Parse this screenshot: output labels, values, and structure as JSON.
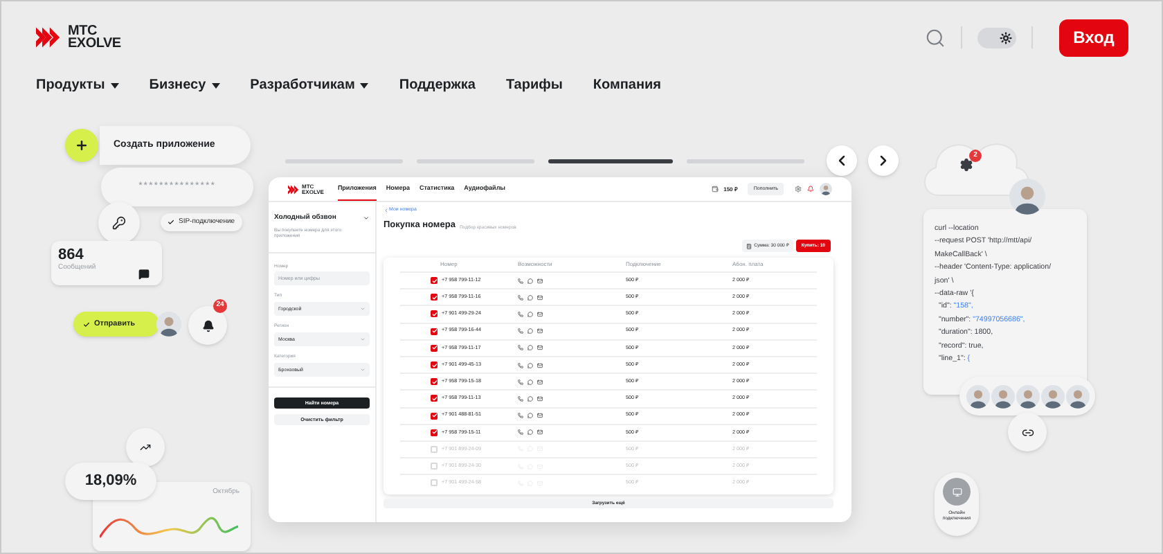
{
  "header": {
    "logo": [
      "МТС",
      "EXOLVE"
    ],
    "theme_toggle": {
      "on": true
    },
    "login_button": "Вход"
  },
  "nav": [
    {
      "label": "Продукты",
      "dropdown": true
    },
    {
      "label": "Бизнесу",
      "dropdown": true
    },
    {
      "label": "Разработчикам",
      "dropdown": true
    },
    {
      "label": "Поддержка",
      "dropdown": false
    },
    {
      "label": "Тарифы",
      "dropdown": false
    },
    {
      "label": "Компания",
      "dropdown": false
    }
  ],
  "carousel": [
    {
      "selected": false
    },
    {
      "selected": false
    },
    {
      "selected": true
    },
    {
      "selected": false
    }
  ],
  "app": {
    "logo": [
      "МТС",
      "EXOLVE"
    ],
    "tabs": [
      {
        "label": "Приложения",
        "selected": true
      },
      {
        "label": "Номера",
        "selected": false
      },
      {
        "label": "Статистика",
        "selected": false
      },
      {
        "label": "Аудиофайлы",
        "selected": false
      }
    ],
    "balance": "150 ₽",
    "topup_button": "Пополнить",
    "sidebar": {
      "title": "Холодный обзвон",
      "description": "Вы покупаете номера для этого приложения",
      "fields": [
        {
          "kind": "text",
          "label": "Номер",
          "placeholder": "Номер или цифры"
        },
        {
          "kind": "select",
          "label": "Тип",
          "value": "Городской"
        },
        {
          "kind": "select",
          "label": "Регион",
          "value": "Москва"
        },
        {
          "kind": "select",
          "label": "Категория",
          "value": "Бронзовый"
        }
      ],
      "find_button": "Найти номера",
      "clear_button": "Очистить фильтр"
    },
    "back_link": "Мои номера",
    "title": "Покупка номера",
    "subtitle": "Подбор красивых номеров",
    "sum": "Сумма: 30 000 ₽",
    "buy_button": "Купить: 10",
    "columns": [
      "Номер",
      "Возможности",
      "Подключение",
      "Абон. плата"
    ],
    "rows": [
      {
        "number": "+7 958 799-11-12",
        "connection": "500 ₽",
        "fee": "2 000 ₽",
        "checked": true
      },
      {
        "number": "+7 958 799-11-16",
        "connection": "500 ₽",
        "fee": "2 000 ₽",
        "checked": true
      },
      {
        "number": "+7 901 499-29-24",
        "connection": "500 ₽",
        "fee": "2 000 ₽",
        "checked": true
      },
      {
        "number": "+7 958 799-16-44",
        "connection": "500 ₽",
        "fee": "2 000 ₽",
        "checked": true
      },
      {
        "number": "+7 958 799-11-17",
        "connection": "500 ₽",
        "fee": "2 000 ₽",
        "checked": true
      },
      {
        "number": "+7 901 499-45-13",
        "connection": "500 ₽",
        "fee": "2 000 ₽",
        "checked": true
      },
      {
        "number": "+7 958 799-15-18",
        "connection": "500 ₽",
        "fee": "2 000 ₽",
        "checked": true
      },
      {
        "number": "+7 958 799-11-13",
        "connection": "500 ₽",
        "fee": "2 000 ₽",
        "checked": true
      },
      {
        "number": "+7 901 488-81-51",
        "connection": "500 ₽",
        "fee": "2 000 ₽",
        "checked": true
      },
      {
        "number": "+7 958 799-15-11",
        "connection": "500 ₽",
        "fee": "2 000 ₽",
        "checked": true
      },
      {
        "number": "+7 901 899-24-09",
        "connection": "500 ₽",
        "fee": "2 000 ₽",
        "checked": false
      },
      {
        "number": "+7 901 899-24-30",
        "connection": "500 ₽",
        "fee": "2 000 ₽",
        "checked": false
      },
      {
        "number": "+7 901 499-24-58",
        "connection": "500 ₽",
        "fee": "2 000 ₽",
        "checked": false
      }
    ],
    "load_more": "Загрузить ещё"
  },
  "left": {
    "create_app": "Создать приложение",
    "password": "***************",
    "sip": "SIP-подключение",
    "messages_count": "864",
    "messages_label": "Сообщений",
    "send_button": "Отправить",
    "bell_badge": "24",
    "percent": "18,09%",
    "month": "Октябрь"
  },
  "right": {
    "cloud_badge": "2",
    "code": [
      {
        "text": "curl --location"
      },
      {
        "text": "--request POST 'http://mtt/api/"
      },
      {
        "text": "MakeCallBack' \\"
      },
      {
        "text": "--header 'Content-Type: application/"
      },
      {
        "text": "json' \\"
      },
      {
        "text": "--data-raw '{"
      },
      {
        "text": "  \"id\": ",
        "value": "\"158\","
      },
      {
        "text": "  \"number\": ",
        "value": "\"74997056686\","
      },
      {
        "text": "  \"duration\": 1800,"
      },
      {
        "text": "  \"record\": true,"
      },
      {
        "text": "  \"line_1\": ",
        "value": "{"
      }
    ],
    "online_label": "Онлайн подключения"
  }
}
